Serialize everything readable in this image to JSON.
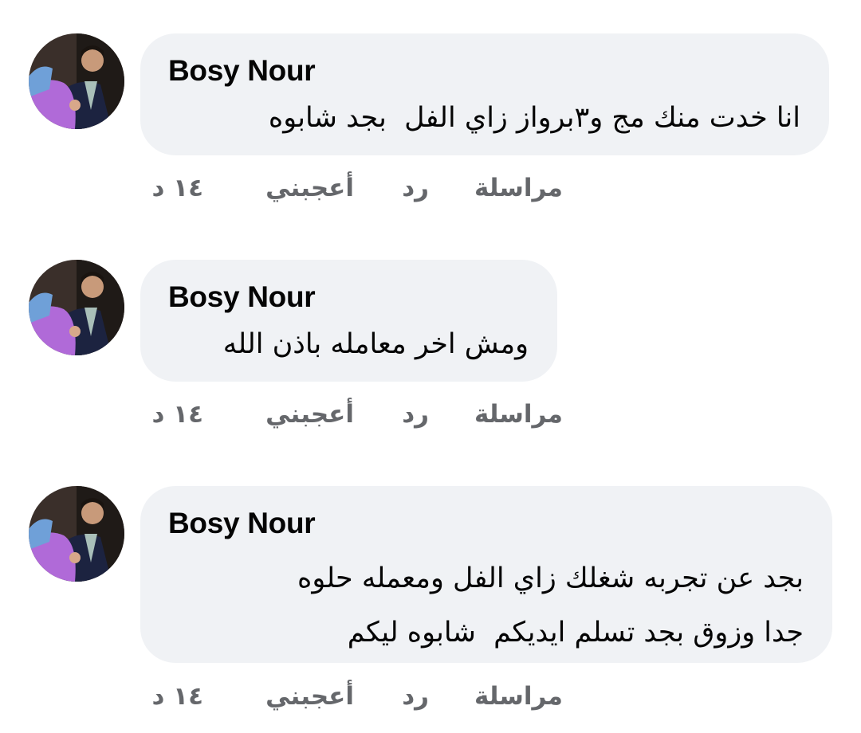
{
  "comments": [
    {
      "author": "Bosy Nour",
      "text": "انا خدت منك مج و٣برواز زاي الفل  بجد شابوه",
      "actions": {
        "message": "مراسلة",
        "reply": "رد",
        "like": "أعجبني",
        "time": "١٤ د"
      }
    },
    {
      "author": "Bosy Nour",
      "text": "ومش اخر معامله باذن الله",
      "actions": {
        "message": "مراسلة",
        "reply": "رد",
        "like": "أعجبني",
        "time": "١٤ د"
      }
    },
    {
      "author": "Bosy Nour",
      "text": "بجد عن تجربه شغلك زاي الفل ومعمله حلوه\nجدا وزوق بجد تسلم ايديكم  شابوه ليكم",
      "actions": {
        "message": "مراسلة",
        "reply": "رد",
        "like": "أعجبني",
        "time": "١٤ د"
      }
    }
  ],
  "colors": {
    "bubble_bg": "#f0f2f5",
    "text": "#050505",
    "secondary_text": "#65676b"
  },
  "icons": [
    "profile-avatar"
  ]
}
